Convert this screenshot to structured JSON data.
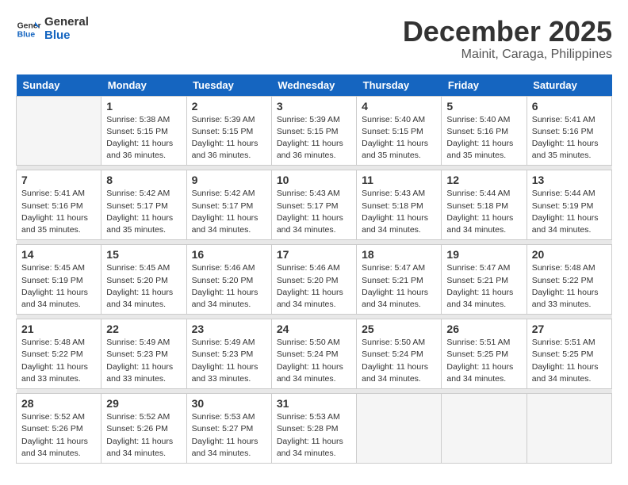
{
  "logo": {
    "line1": "General",
    "line2": "Blue"
  },
  "title": "December 2025",
  "subtitle": "Mainit, Caraga, Philippines",
  "days_header": [
    "Sunday",
    "Monday",
    "Tuesday",
    "Wednesday",
    "Thursday",
    "Friday",
    "Saturday"
  ],
  "weeks": [
    [
      {
        "day": "",
        "info": ""
      },
      {
        "day": "1",
        "info": "Sunrise: 5:38 AM\nSunset: 5:15 PM\nDaylight: 11 hours\nand 36 minutes."
      },
      {
        "day": "2",
        "info": "Sunrise: 5:39 AM\nSunset: 5:15 PM\nDaylight: 11 hours\nand 36 minutes."
      },
      {
        "day": "3",
        "info": "Sunrise: 5:39 AM\nSunset: 5:15 PM\nDaylight: 11 hours\nand 36 minutes."
      },
      {
        "day": "4",
        "info": "Sunrise: 5:40 AM\nSunset: 5:15 PM\nDaylight: 11 hours\nand 35 minutes."
      },
      {
        "day": "5",
        "info": "Sunrise: 5:40 AM\nSunset: 5:16 PM\nDaylight: 11 hours\nand 35 minutes."
      },
      {
        "day": "6",
        "info": "Sunrise: 5:41 AM\nSunset: 5:16 PM\nDaylight: 11 hours\nand 35 minutes."
      }
    ],
    [
      {
        "day": "7",
        "info": "Sunrise: 5:41 AM\nSunset: 5:16 PM\nDaylight: 11 hours\nand 35 minutes."
      },
      {
        "day": "8",
        "info": "Sunrise: 5:42 AM\nSunset: 5:17 PM\nDaylight: 11 hours\nand 35 minutes."
      },
      {
        "day": "9",
        "info": "Sunrise: 5:42 AM\nSunset: 5:17 PM\nDaylight: 11 hours\nand 34 minutes."
      },
      {
        "day": "10",
        "info": "Sunrise: 5:43 AM\nSunset: 5:17 PM\nDaylight: 11 hours\nand 34 minutes."
      },
      {
        "day": "11",
        "info": "Sunrise: 5:43 AM\nSunset: 5:18 PM\nDaylight: 11 hours\nand 34 minutes."
      },
      {
        "day": "12",
        "info": "Sunrise: 5:44 AM\nSunset: 5:18 PM\nDaylight: 11 hours\nand 34 minutes."
      },
      {
        "day": "13",
        "info": "Sunrise: 5:44 AM\nSunset: 5:19 PM\nDaylight: 11 hours\nand 34 minutes."
      }
    ],
    [
      {
        "day": "14",
        "info": "Sunrise: 5:45 AM\nSunset: 5:19 PM\nDaylight: 11 hours\nand 34 minutes."
      },
      {
        "day": "15",
        "info": "Sunrise: 5:45 AM\nSunset: 5:20 PM\nDaylight: 11 hours\nand 34 minutes."
      },
      {
        "day": "16",
        "info": "Sunrise: 5:46 AM\nSunset: 5:20 PM\nDaylight: 11 hours\nand 34 minutes."
      },
      {
        "day": "17",
        "info": "Sunrise: 5:46 AM\nSunset: 5:20 PM\nDaylight: 11 hours\nand 34 minutes."
      },
      {
        "day": "18",
        "info": "Sunrise: 5:47 AM\nSunset: 5:21 PM\nDaylight: 11 hours\nand 34 minutes."
      },
      {
        "day": "19",
        "info": "Sunrise: 5:47 AM\nSunset: 5:21 PM\nDaylight: 11 hours\nand 34 minutes."
      },
      {
        "day": "20",
        "info": "Sunrise: 5:48 AM\nSunset: 5:22 PM\nDaylight: 11 hours\nand 33 minutes."
      }
    ],
    [
      {
        "day": "21",
        "info": "Sunrise: 5:48 AM\nSunset: 5:22 PM\nDaylight: 11 hours\nand 33 minutes."
      },
      {
        "day": "22",
        "info": "Sunrise: 5:49 AM\nSunset: 5:23 PM\nDaylight: 11 hours\nand 33 minutes."
      },
      {
        "day": "23",
        "info": "Sunrise: 5:49 AM\nSunset: 5:23 PM\nDaylight: 11 hours\nand 33 minutes."
      },
      {
        "day": "24",
        "info": "Sunrise: 5:50 AM\nSunset: 5:24 PM\nDaylight: 11 hours\nand 34 minutes."
      },
      {
        "day": "25",
        "info": "Sunrise: 5:50 AM\nSunset: 5:24 PM\nDaylight: 11 hours\nand 34 minutes."
      },
      {
        "day": "26",
        "info": "Sunrise: 5:51 AM\nSunset: 5:25 PM\nDaylight: 11 hours\nand 34 minutes."
      },
      {
        "day": "27",
        "info": "Sunrise: 5:51 AM\nSunset: 5:25 PM\nDaylight: 11 hours\nand 34 minutes."
      }
    ],
    [
      {
        "day": "28",
        "info": "Sunrise: 5:52 AM\nSunset: 5:26 PM\nDaylight: 11 hours\nand 34 minutes."
      },
      {
        "day": "29",
        "info": "Sunrise: 5:52 AM\nSunset: 5:26 PM\nDaylight: 11 hours\nand 34 minutes."
      },
      {
        "day": "30",
        "info": "Sunrise: 5:53 AM\nSunset: 5:27 PM\nDaylight: 11 hours\nand 34 minutes."
      },
      {
        "day": "31",
        "info": "Sunrise: 5:53 AM\nSunset: 5:28 PM\nDaylight: 11 hours\nand 34 minutes."
      },
      {
        "day": "",
        "info": ""
      },
      {
        "day": "",
        "info": ""
      },
      {
        "day": "",
        "info": ""
      }
    ]
  ]
}
